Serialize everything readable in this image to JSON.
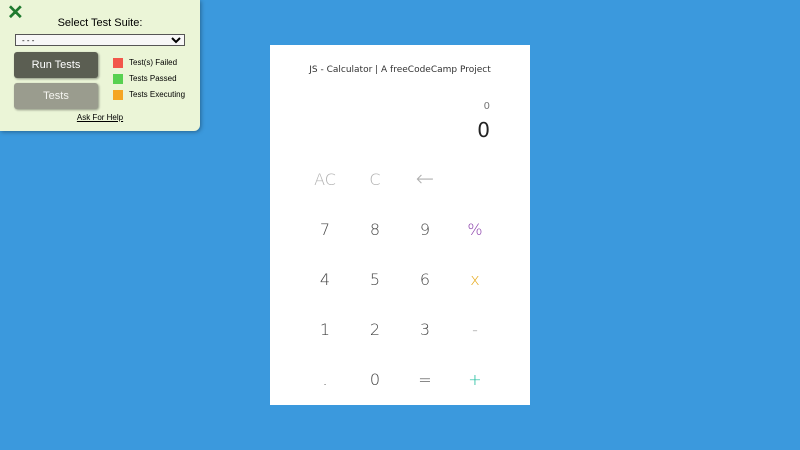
{
  "test_panel": {
    "close_label": "✕",
    "title": "Select Test Suite:",
    "select_value": "- - -",
    "run_button": "Run Tests",
    "tests_button": "Tests",
    "legend": [
      {
        "label": "Test(s) Failed",
        "color": "#f2564b"
      },
      {
        "label": "Tests Passed",
        "color": "#58d151"
      },
      {
        "label": "Tests Executing",
        "color": "#f5a623"
      }
    ],
    "help_link": "Ask For Help"
  },
  "calculator": {
    "title": "JS - Calculator | A freeCodeCamp Project",
    "formula": "0",
    "display": "0",
    "colors": {
      "percent": "#8e44ad",
      "multiply": "#e6a817",
      "subtract": "#999999",
      "add": "#1abc9c"
    },
    "keys": {
      "clear_all": "AC",
      "clear": "C",
      "backspace": "←",
      "seven": "7",
      "eight": "8",
      "nine": "9",
      "percent": "%",
      "four": "4",
      "five": "5",
      "six": "6",
      "multiply": "x",
      "one": "1",
      "two": "2",
      "three": "3",
      "subtract": "-",
      "decimal": ".",
      "zero": "0",
      "equals": "=",
      "add": "+"
    }
  }
}
